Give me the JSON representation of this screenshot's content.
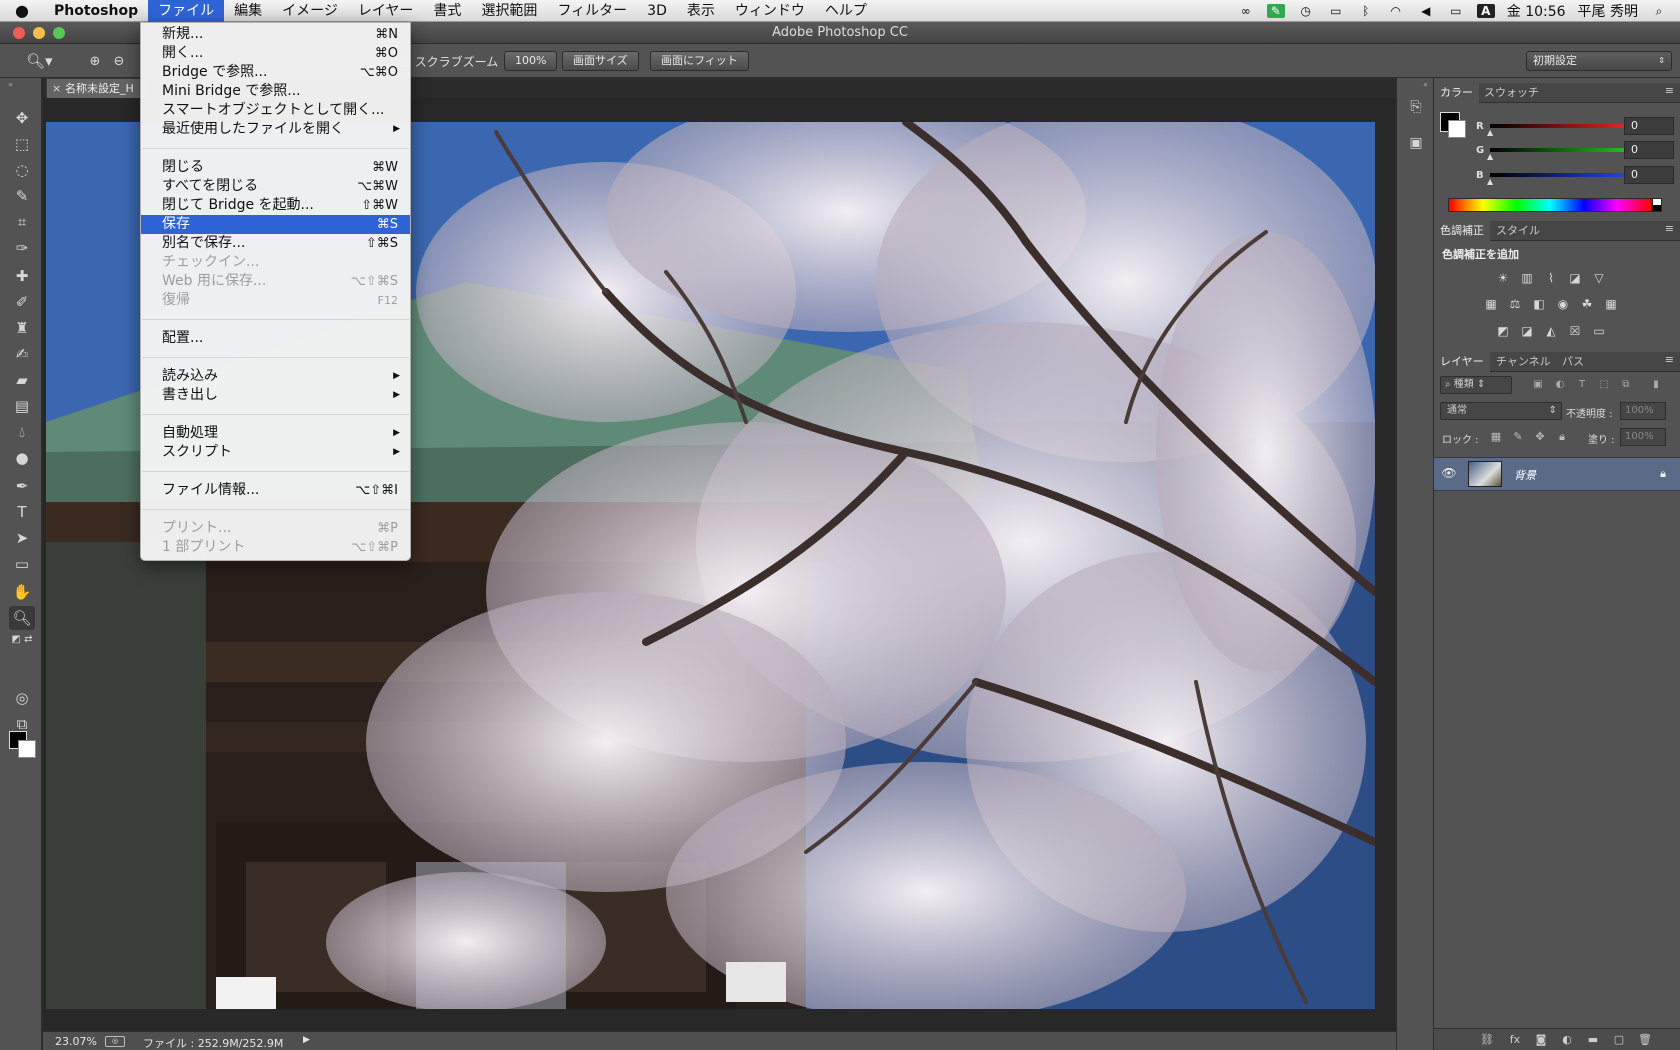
{
  "menubar": {
    "app_name": "Photoshop",
    "menus": [
      "ファイル",
      "編集",
      "イメージ",
      "レイヤー",
      "書式",
      "選択範囲",
      "フィルター",
      "3D",
      "表示",
      "ウィンドウ",
      "ヘルプ"
    ],
    "tray_a": "A",
    "clock": "金 10:56",
    "user": "平尾 秀明"
  },
  "window": {
    "title": "Adobe Photoshop CC"
  },
  "options_bar": {
    "scrubby_zoom": "スクラブズーム",
    "btn_100": "100%",
    "btn_screen_size": "画面サイズ",
    "btn_fit_screen": "画面にフィット",
    "workspace": "初期設定"
  },
  "document": {
    "tab_label": "名称未設定_H",
    "status_zoom": "23.07%",
    "status_file": "ファイル : 252.9M/252.9M"
  },
  "file_menu": {
    "new": {
      "label": "新規...",
      "shortcut": "⌘N"
    },
    "open": {
      "label": "開く...",
      "shortcut": "⌘O"
    },
    "browse_bridge": {
      "label": "Bridge で参照...",
      "shortcut": "⌥⌘O"
    },
    "browse_mini_bridge": {
      "label": "Mini Bridge で参照..."
    },
    "open_smart_object": {
      "label": "スマートオブジェクトとして開く..."
    },
    "open_recent": {
      "label": "最近使用したファイルを開く"
    },
    "close": {
      "label": "閉じる",
      "shortcut": "⌘W"
    },
    "close_all": {
      "label": "すべてを閉じる",
      "shortcut": "⌥⌘W"
    },
    "close_go_bridge": {
      "label": "閉じて Bridge を起動...",
      "shortcut": "⇧⌘W"
    },
    "save": {
      "label": "保存",
      "shortcut": "⌘S"
    },
    "save_as": {
      "label": "別名で保存...",
      "shortcut": "⇧⌘S"
    },
    "check_in": {
      "label": "チェックイン..."
    },
    "save_for_web": {
      "label": "Web 用に保存...",
      "shortcut": "⌥⇧⌘S"
    },
    "revert": {
      "label": "復帰",
      "shortcut": "F12"
    },
    "place": {
      "label": "配置..."
    },
    "import": {
      "label": "読み込み"
    },
    "export": {
      "label": "書き出し"
    },
    "automate": {
      "label": "自動処理"
    },
    "scripts": {
      "label": "スクリプト"
    },
    "file_info": {
      "label": "ファイル情報...",
      "shortcut": "⌥⇧⌘I"
    },
    "print": {
      "label": "プリント...",
      "shortcut": "⌘P"
    },
    "print_one": {
      "label": "1 部プリント",
      "shortcut": "⌥⇧⌘P"
    }
  },
  "color_panel": {
    "tabs": [
      "カラー",
      "スウォッチ"
    ],
    "channels": [
      {
        "label": "R",
        "value": "0",
        "color": "#ff2a2a"
      },
      {
        "label": "G",
        "value": "0",
        "color": "#2ad42a"
      },
      {
        "label": "B",
        "value": "0",
        "color": "#2a4dff"
      }
    ]
  },
  "adjustments_panel": {
    "tabs": [
      "色調補正",
      "スタイル"
    ],
    "title": "色調補正を追加"
  },
  "layers_panel": {
    "tabs": [
      "レイヤー",
      "チャンネル",
      "パス"
    ],
    "kind": "種類",
    "blend_mode": "通常",
    "opacity_label": "不透明度 :",
    "opacity_value": "100%",
    "lock_label": "ロック :",
    "fill_label": "塗り :",
    "fill_value": "100%",
    "layer_name": "背景"
  },
  "colors": {
    "menu_highlight": "#2f64d6",
    "panel_bg": "#535353",
    "layer_selected": "#5a6b88"
  }
}
